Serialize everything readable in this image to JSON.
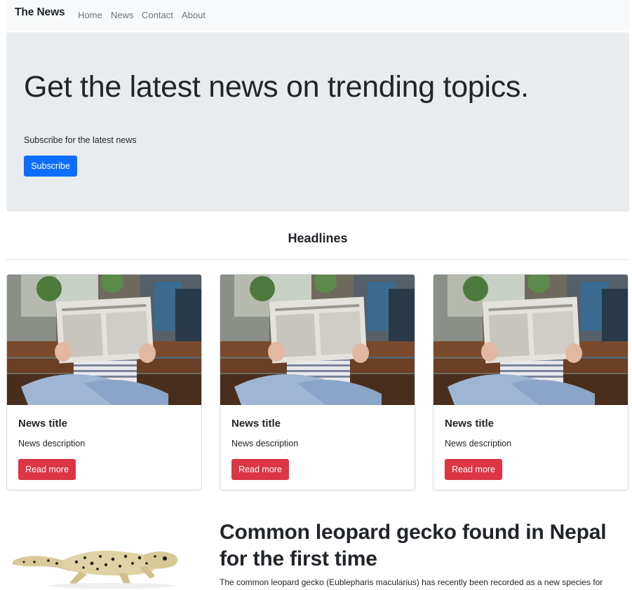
{
  "navbar": {
    "brand": "The News",
    "links": [
      "Home",
      "News",
      "Contact",
      "About"
    ]
  },
  "hero": {
    "heading": "Get the latest news on trending topics.",
    "subtext": "Subscribe for the latest news",
    "button_label": "Subscribe"
  },
  "section": {
    "heading": "Headlines"
  },
  "cards": [
    {
      "title": "News title",
      "description": "News description",
      "button_label": "Read more",
      "image": "newspaper-reader-photo"
    },
    {
      "title": "News title",
      "description": "News description",
      "button_label": "Read more",
      "image": "newspaper-reader-photo"
    },
    {
      "title": "News title",
      "description": "News description",
      "button_label": "Read more",
      "image": "newspaper-reader-photo"
    }
  ],
  "article": {
    "image": "leopard-gecko-photo",
    "title": "Common leopard gecko found in Nepal for the first time",
    "body": "The common leopard gecko (Eublepharis macularius) has recently been recorded as a new species for"
  },
  "colors": {
    "primary": "#0d6efd",
    "danger": "#dc3545",
    "navbar_bg": "#f8f9fa",
    "hero_bg": "#e9ecef"
  }
}
